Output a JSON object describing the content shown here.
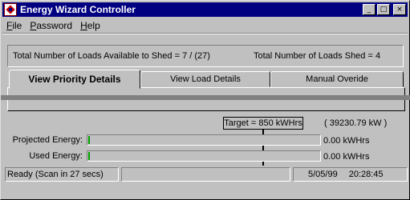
{
  "window": {
    "title": "Energy Wizard Controller"
  },
  "title_buttons": {
    "minimize": "_",
    "maximize": "□",
    "close": "×"
  },
  "menu": [
    {
      "label": "File",
      "mnemonic": "F",
      "rest": "ile"
    },
    {
      "label": "Password",
      "mnemonic": "P",
      "rest": "assword"
    },
    {
      "label": "Help",
      "mnemonic": "H",
      "rest": "elp"
    }
  ],
  "summary": {
    "available": "Total Number of Loads Available to Shed = 7 / (27)",
    "shed": "Total Number of Loads Shed = 4"
  },
  "tabs": [
    {
      "label": "View Priority Details",
      "active": true
    },
    {
      "label": "View Load Details",
      "active": false
    },
    {
      "label": "Manual Overide",
      "active": false
    }
  ],
  "energy": {
    "target": "Target = 850 kWHrs",
    "target_kw": "( 39230.79 kW )",
    "projected_label": "Projected Energy:",
    "projected_value": "0.00 kWHrs",
    "projected_fraction": 0.0,
    "used_label": "Used Energy:",
    "used_value": "0.00 kWHrs",
    "used_fraction": 0.0,
    "accent_color": "#00a000"
  },
  "statusbar": {
    "status": "Ready (Scan in 27 secs)",
    "date": "5/05/99",
    "time": "20:28:45"
  }
}
